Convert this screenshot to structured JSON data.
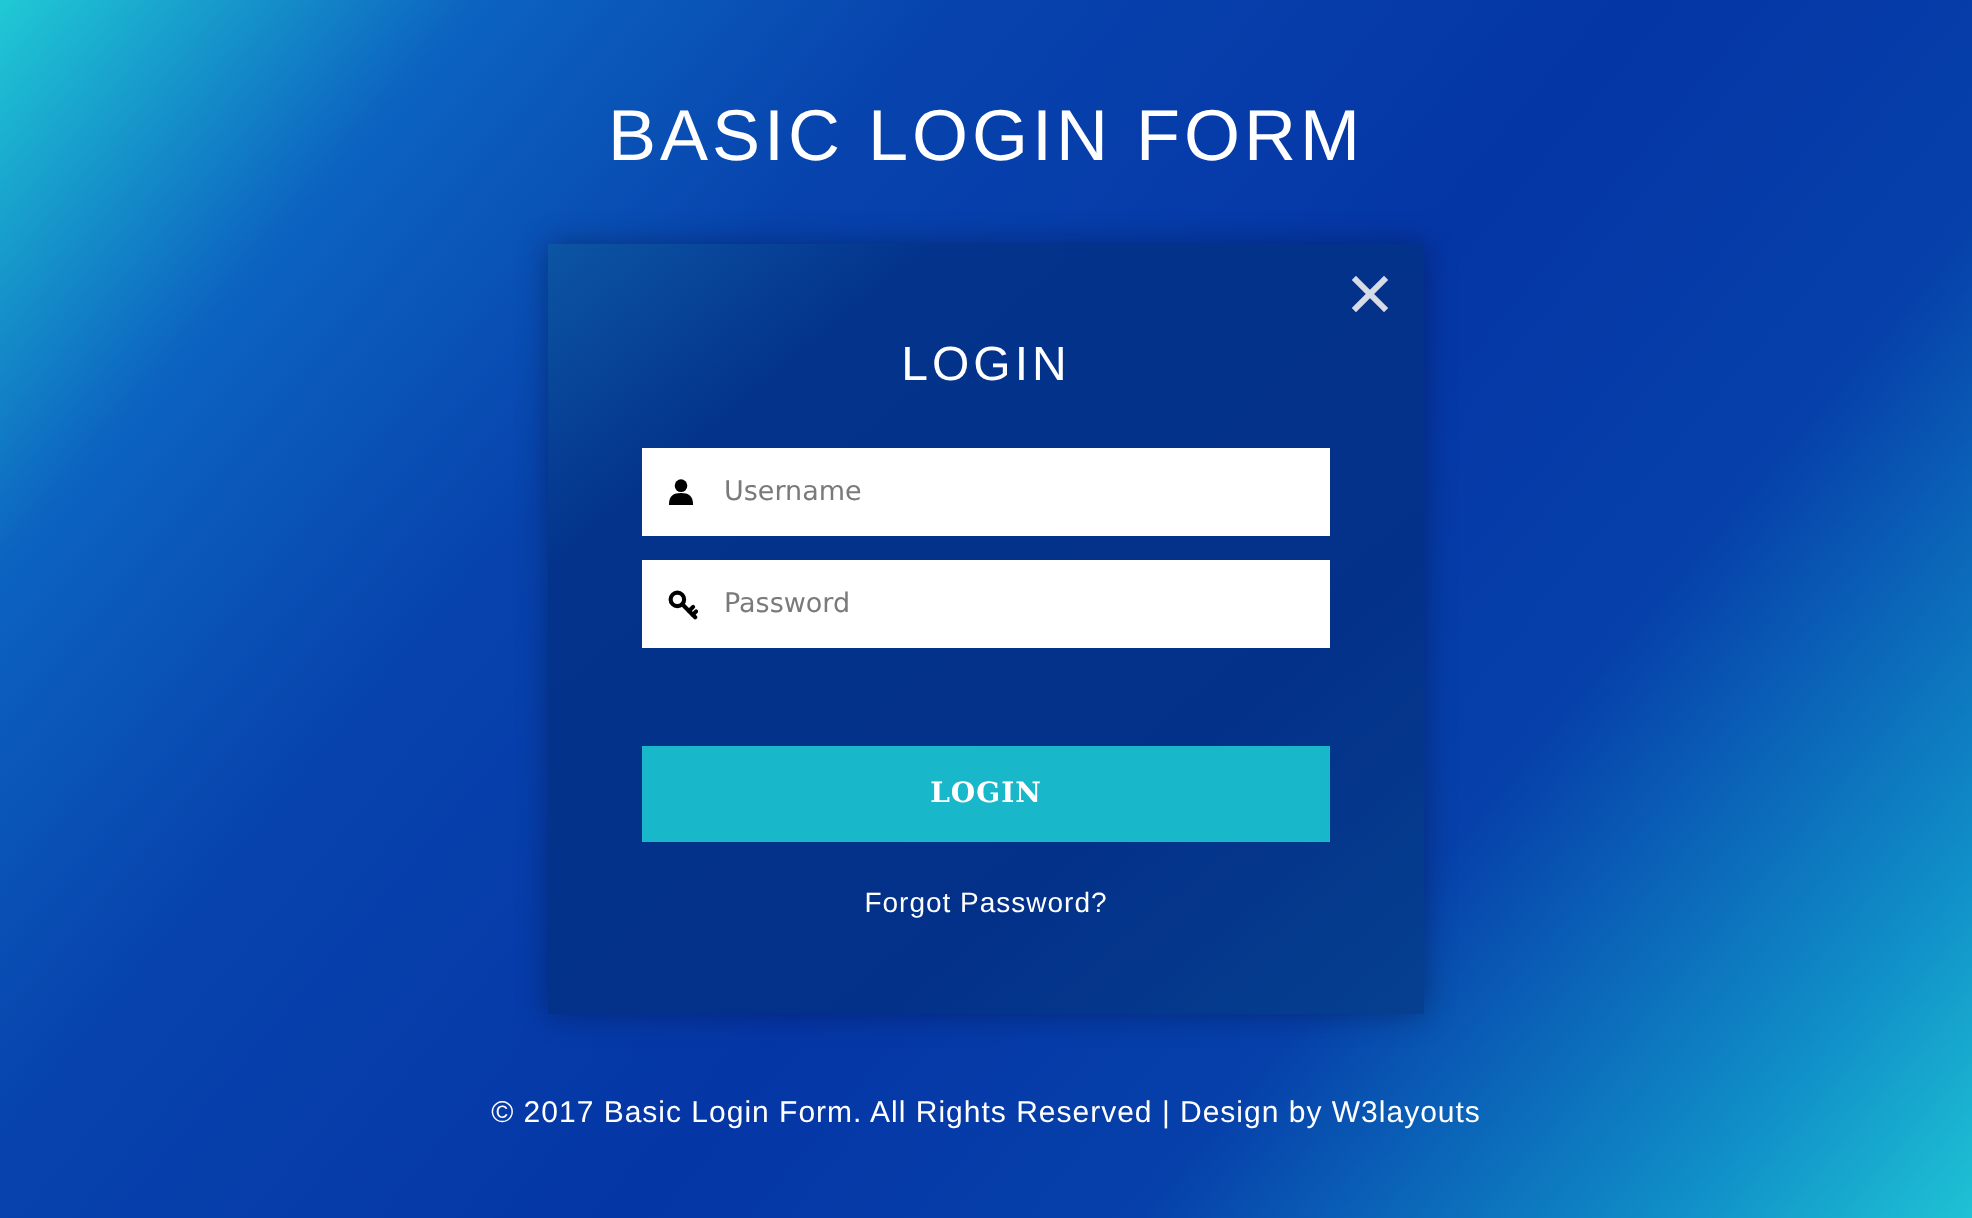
{
  "page_title": "BASIC LOGIN FORM",
  "login_card": {
    "heading": "LOGIN",
    "fields": [
      {
        "kind": "username",
        "placeholder": "Username"
      },
      {
        "kind": "password",
        "placeholder": "Password"
      }
    ],
    "submit": "LOGIN",
    "forgot_link": "Forgot Password?"
  },
  "footer": {
    "text": "© 2017 Basic Login Form. All Rights Reserved | Design by",
    "link": "W3layouts"
  }
}
